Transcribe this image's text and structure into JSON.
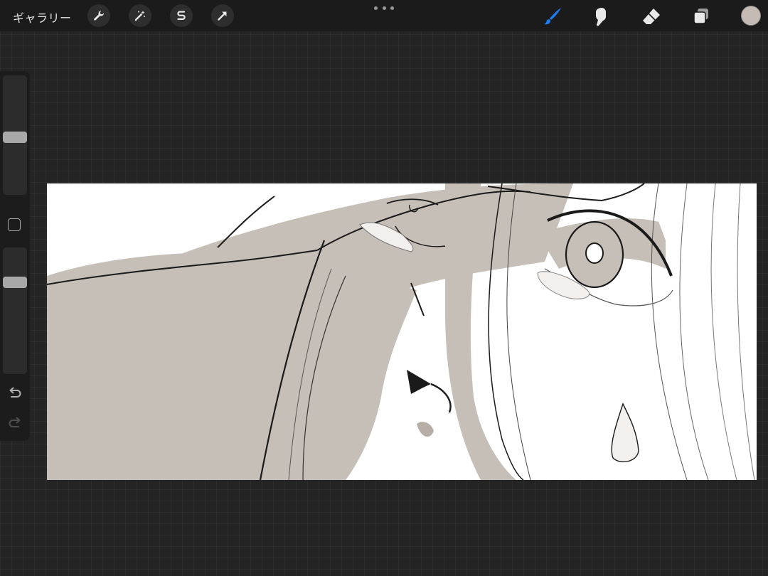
{
  "topbar": {
    "gallery_label": "ギャラリー",
    "left_tools": [
      "wrench-icon",
      "magic-wand-icon",
      "selection-s-icon",
      "transform-arrow-icon"
    ],
    "right_tools": [
      "brush-icon",
      "smudge-icon",
      "eraser-icon",
      "layers-icon"
    ],
    "active_tool": "brush-icon"
  },
  "sidebar": {
    "brush_size_fraction": 0.48,
    "opacity_fraction": 0.75
  },
  "colors": {
    "accent": "#1e7cf0",
    "current_color": "#c4bcb4",
    "canvas_tone": "#c6bfb8",
    "background": "#242424"
  }
}
